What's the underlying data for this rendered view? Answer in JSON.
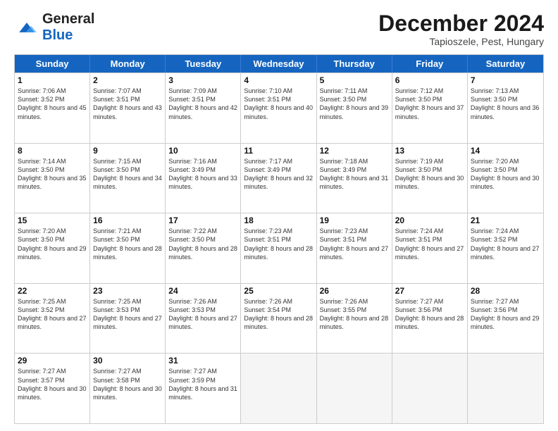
{
  "header": {
    "logo_general": "General",
    "logo_blue": "Blue",
    "month_title": "December 2024",
    "subtitle": "Tapioszele, Pest, Hungary"
  },
  "days_of_week": [
    "Sunday",
    "Monday",
    "Tuesday",
    "Wednesday",
    "Thursday",
    "Friday",
    "Saturday"
  ],
  "rows": [
    [
      {
        "day": "",
        "sunrise": "",
        "sunset": "",
        "daylight": "",
        "empty": true
      },
      {
        "day": "2",
        "sunrise": "Sunrise: 7:07 AM",
        "sunset": "Sunset: 3:51 PM",
        "daylight": "Daylight: 8 hours and 43 minutes."
      },
      {
        "day": "3",
        "sunrise": "Sunrise: 7:09 AM",
        "sunset": "Sunset: 3:51 PM",
        "daylight": "Daylight: 8 hours and 42 minutes."
      },
      {
        "day": "4",
        "sunrise": "Sunrise: 7:10 AM",
        "sunset": "Sunset: 3:51 PM",
        "daylight": "Daylight: 8 hours and 40 minutes."
      },
      {
        "day": "5",
        "sunrise": "Sunrise: 7:11 AM",
        "sunset": "Sunset: 3:50 PM",
        "daylight": "Daylight: 8 hours and 39 minutes."
      },
      {
        "day": "6",
        "sunrise": "Sunrise: 7:12 AM",
        "sunset": "Sunset: 3:50 PM",
        "daylight": "Daylight: 8 hours and 37 minutes."
      },
      {
        "day": "7",
        "sunrise": "Sunrise: 7:13 AM",
        "sunset": "Sunset: 3:50 PM",
        "daylight": "Daylight: 8 hours and 36 minutes."
      }
    ],
    [
      {
        "day": "8",
        "sunrise": "Sunrise: 7:14 AM",
        "sunset": "Sunset: 3:50 PM",
        "daylight": "Daylight: 8 hours and 35 minutes."
      },
      {
        "day": "9",
        "sunrise": "Sunrise: 7:15 AM",
        "sunset": "Sunset: 3:50 PM",
        "daylight": "Daylight: 8 hours and 34 minutes."
      },
      {
        "day": "10",
        "sunrise": "Sunrise: 7:16 AM",
        "sunset": "Sunset: 3:49 PM",
        "daylight": "Daylight: 8 hours and 33 minutes."
      },
      {
        "day": "11",
        "sunrise": "Sunrise: 7:17 AM",
        "sunset": "Sunset: 3:49 PM",
        "daylight": "Daylight: 8 hours and 32 minutes."
      },
      {
        "day": "12",
        "sunrise": "Sunrise: 7:18 AM",
        "sunset": "Sunset: 3:49 PM",
        "daylight": "Daylight: 8 hours and 31 minutes."
      },
      {
        "day": "13",
        "sunrise": "Sunrise: 7:19 AM",
        "sunset": "Sunset: 3:50 PM",
        "daylight": "Daylight: 8 hours and 30 minutes."
      },
      {
        "day": "14",
        "sunrise": "Sunrise: 7:20 AM",
        "sunset": "Sunset: 3:50 PM",
        "daylight": "Daylight: 8 hours and 30 minutes."
      }
    ],
    [
      {
        "day": "15",
        "sunrise": "Sunrise: 7:20 AM",
        "sunset": "Sunset: 3:50 PM",
        "daylight": "Daylight: 8 hours and 29 minutes."
      },
      {
        "day": "16",
        "sunrise": "Sunrise: 7:21 AM",
        "sunset": "Sunset: 3:50 PM",
        "daylight": "Daylight: 8 hours and 28 minutes."
      },
      {
        "day": "17",
        "sunrise": "Sunrise: 7:22 AM",
        "sunset": "Sunset: 3:50 PM",
        "daylight": "Daylight: 8 hours and 28 minutes."
      },
      {
        "day": "18",
        "sunrise": "Sunrise: 7:23 AM",
        "sunset": "Sunset: 3:51 PM",
        "daylight": "Daylight: 8 hours and 28 minutes."
      },
      {
        "day": "19",
        "sunrise": "Sunrise: 7:23 AM",
        "sunset": "Sunset: 3:51 PM",
        "daylight": "Daylight: 8 hours and 27 minutes."
      },
      {
        "day": "20",
        "sunrise": "Sunrise: 7:24 AM",
        "sunset": "Sunset: 3:51 PM",
        "daylight": "Daylight: 8 hours and 27 minutes."
      },
      {
        "day": "21",
        "sunrise": "Sunrise: 7:24 AM",
        "sunset": "Sunset: 3:52 PM",
        "daylight": "Daylight: 8 hours and 27 minutes."
      }
    ],
    [
      {
        "day": "22",
        "sunrise": "Sunrise: 7:25 AM",
        "sunset": "Sunset: 3:52 PM",
        "daylight": "Daylight: 8 hours and 27 minutes."
      },
      {
        "day": "23",
        "sunrise": "Sunrise: 7:25 AM",
        "sunset": "Sunset: 3:53 PM",
        "daylight": "Daylight: 8 hours and 27 minutes."
      },
      {
        "day": "24",
        "sunrise": "Sunrise: 7:26 AM",
        "sunset": "Sunset: 3:53 PM",
        "daylight": "Daylight: 8 hours and 27 minutes."
      },
      {
        "day": "25",
        "sunrise": "Sunrise: 7:26 AM",
        "sunset": "Sunset: 3:54 PM",
        "daylight": "Daylight: 8 hours and 28 minutes."
      },
      {
        "day": "26",
        "sunrise": "Sunrise: 7:26 AM",
        "sunset": "Sunset: 3:55 PM",
        "daylight": "Daylight: 8 hours and 28 minutes."
      },
      {
        "day": "27",
        "sunrise": "Sunrise: 7:27 AM",
        "sunset": "Sunset: 3:56 PM",
        "daylight": "Daylight: 8 hours and 28 minutes."
      },
      {
        "day": "28",
        "sunrise": "Sunrise: 7:27 AM",
        "sunset": "Sunset: 3:56 PM",
        "daylight": "Daylight: 8 hours and 29 minutes."
      }
    ],
    [
      {
        "day": "29",
        "sunrise": "Sunrise: 7:27 AM",
        "sunset": "Sunset: 3:57 PM",
        "daylight": "Daylight: 8 hours and 30 minutes."
      },
      {
        "day": "30",
        "sunrise": "Sunrise: 7:27 AM",
        "sunset": "Sunset: 3:58 PM",
        "daylight": "Daylight: 8 hours and 30 minutes."
      },
      {
        "day": "31",
        "sunrise": "Sunrise: 7:27 AM",
        "sunset": "Sunset: 3:59 PM",
        "daylight": "Daylight: 8 hours and 31 minutes."
      },
      {
        "day": "",
        "sunrise": "",
        "sunset": "",
        "daylight": "",
        "empty": true
      },
      {
        "day": "",
        "sunrise": "",
        "sunset": "",
        "daylight": "",
        "empty": true
      },
      {
        "day": "",
        "sunrise": "",
        "sunset": "",
        "daylight": "",
        "empty": true
      },
      {
        "day": "",
        "sunrise": "",
        "sunset": "",
        "daylight": "",
        "empty": true
      }
    ]
  ],
  "row1_day1": {
    "day": "1",
    "sunrise": "Sunrise: 7:06 AM",
    "sunset": "Sunset: 3:52 PM",
    "daylight": "Daylight: 8 hours and 45 minutes."
  }
}
